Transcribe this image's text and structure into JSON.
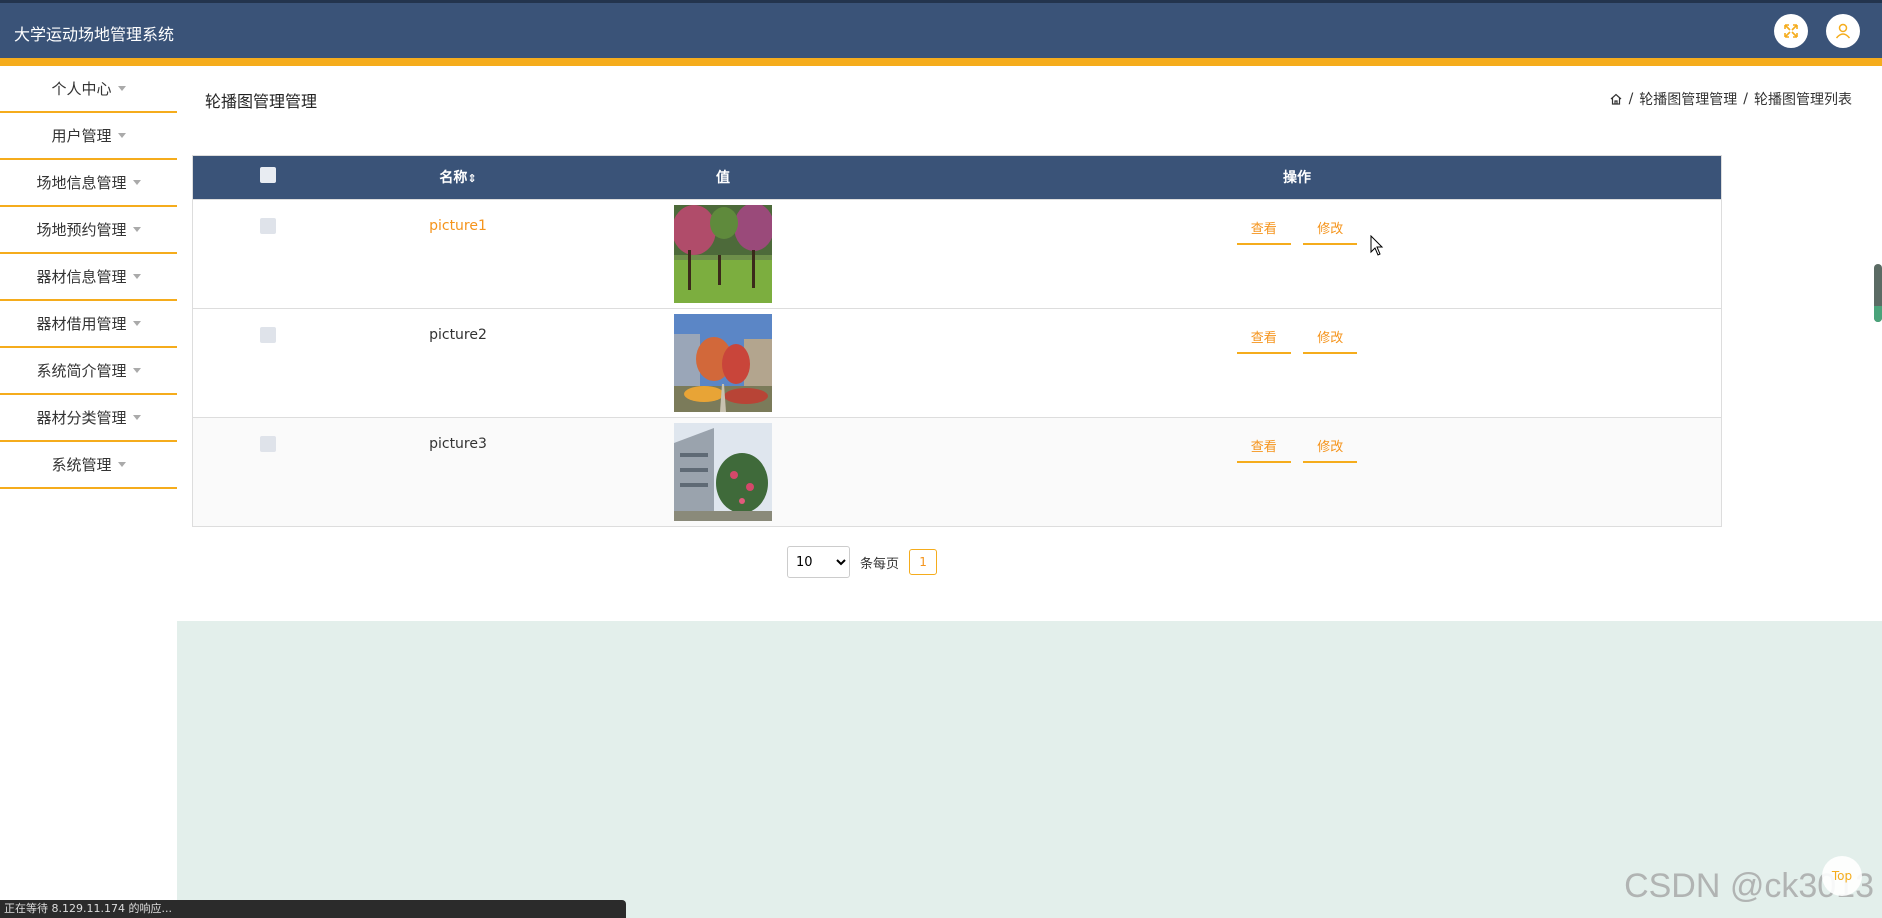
{
  "app": {
    "title": "大学运动场地管理系统"
  },
  "sidebar": {
    "items": [
      {
        "label": "个人中心"
      },
      {
        "label": "用户管理"
      },
      {
        "label": "场地信息管理"
      },
      {
        "label": "场地预约管理"
      },
      {
        "label": "器材信息管理"
      },
      {
        "label": "器材借用管理"
      },
      {
        "label": "系统简介管理"
      },
      {
        "label": "器材分类管理"
      },
      {
        "label": "系统管理"
      }
    ]
  },
  "page": {
    "title": "轮播图管理管理",
    "breadcrumb": {
      "sep": "/",
      "section": "轮播图管理管理",
      "current": "轮播图管理列表"
    }
  },
  "table": {
    "headers": {
      "name": "名称",
      "value": "值",
      "actions": "操作"
    },
    "rows": [
      {
        "name": "picture1",
        "view": "查看",
        "edit": "修改"
      },
      {
        "name": "picture2",
        "view": "查看",
        "edit": "修改"
      },
      {
        "name": "picture3",
        "view": "查看",
        "edit": "修改"
      }
    ]
  },
  "pagination": {
    "page_size": "10",
    "per_page_label": "条每页",
    "current_page": "1"
  },
  "status_bar": {
    "text": "正在等待 8.129.11.174 的响应..."
  },
  "watermark": "CSDN @ck3013",
  "back_to_top": "Top",
  "colors": {
    "header": "#3a5378",
    "accent": "#f5ac1c",
    "link": "#f5941c"
  }
}
